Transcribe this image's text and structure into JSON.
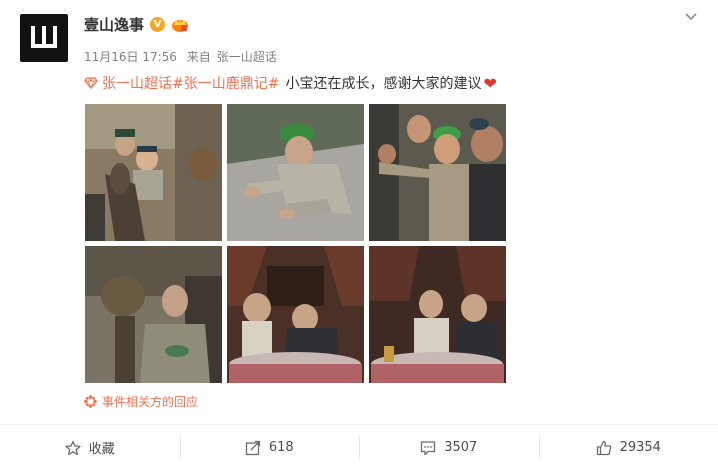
{
  "post": {
    "author": "壹山逸事",
    "date": "11月16日 17:56",
    "source_prefix": "来自",
    "source_name": "张一山超话",
    "topic_link": "张一山超话",
    "hashtag": "#张一山鹿鼎记#",
    "text": "小宝还在成长，感谢大家的建议",
    "related_link": "事件相关方的回应"
  },
  "actions": {
    "favorite_label": "收藏",
    "repost_count": "618",
    "comment_count": "3507",
    "like_count": "29354"
  },
  "colors": {
    "accent": "#eb7350",
    "verified": "#f5a623",
    "heart": "#e2382b"
  },
  "photos": [
    {
      "desc_icon": "photo-donkey-rider"
    },
    {
      "desc_icon": "photo-crawling-man"
    },
    {
      "desc_icon": "photo-pointing-crowd"
    },
    {
      "desc_icon": "photo-man-eating"
    },
    {
      "desc_icon": "photo-table-scene-1"
    },
    {
      "desc_icon": "photo-table-scene-2"
    }
  ]
}
